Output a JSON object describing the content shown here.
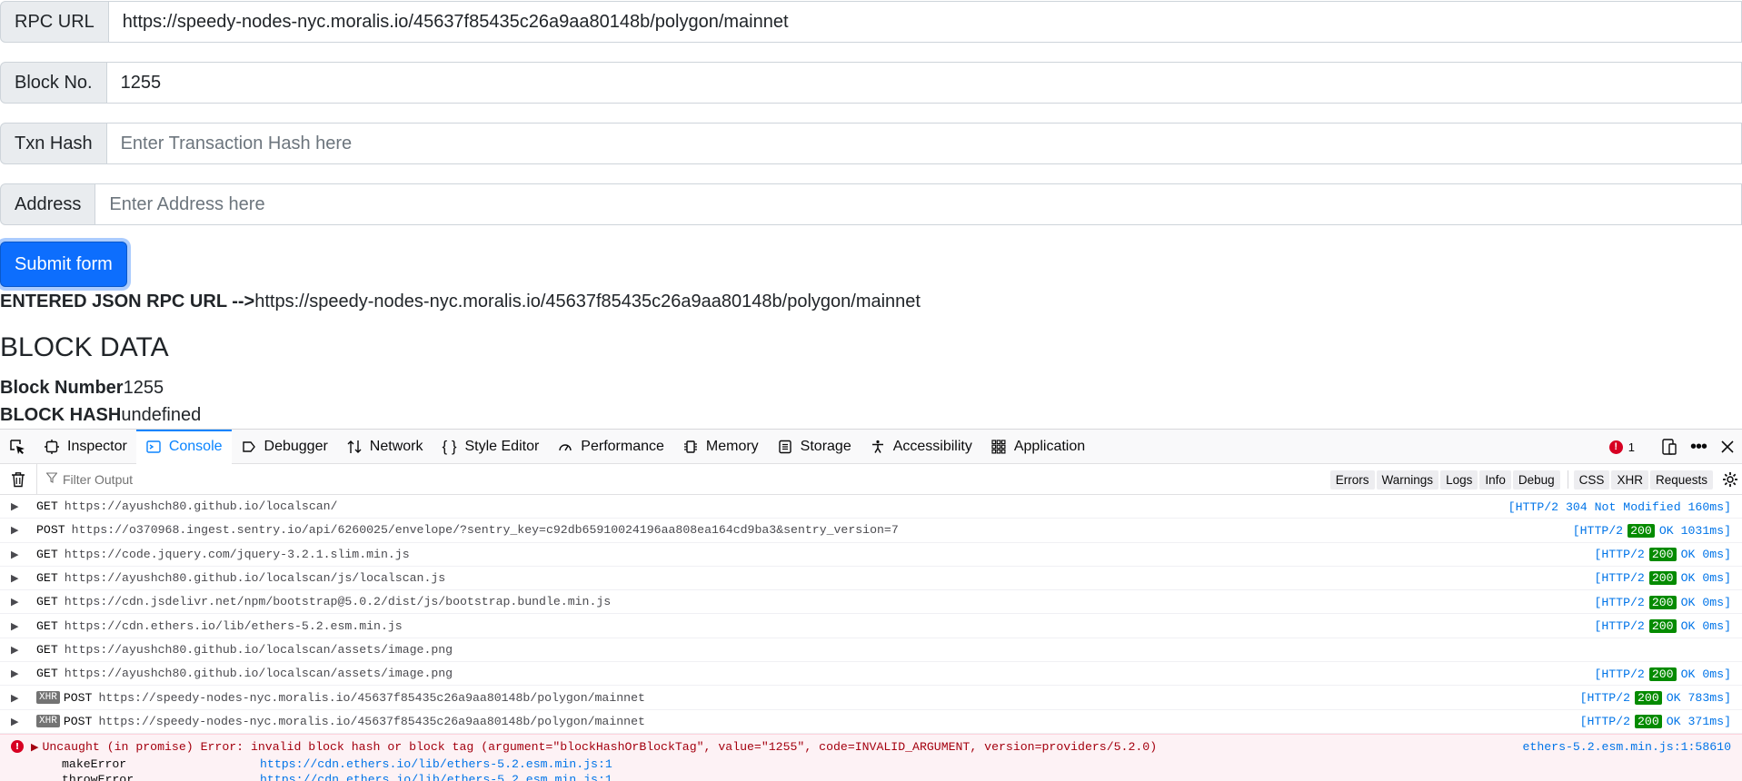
{
  "form": {
    "rpc": {
      "label": "RPC URL",
      "value": "https://speedy-nodes-nyc.moralis.io/45637f85435c26a9aa80148b/polygon/mainnet",
      "placeholder": ""
    },
    "block": {
      "label": "Block No.",
      "value": "1255",
      "placeholder": ""
    },
    "txn": {
      "label": "Txn Hash",
      "value": "",
      "placeholder": "Enter Transaction Hash here"
    },
    "address": {
      "label": "Address",
      "value": "",
      "placeholder": "Enter Address here"
    },
    "submit_label": "Submit form"
  },
  "result": {
    "rpc_label": "ENTERED JSON RPC URL -->",
    "rpc_value": "https://speedy-nodes-nyc.moralis.io/45637f85435c26a9aa80148b/polygon/mainnet",
    "block_title": "BLOCK DATA",
    "block_number_label": "Block Number",
    "block_number_value": "1255",
    "block_hash_label": "BLOCK HASH",
    "block_hash_value": "undefined"
  },
  "devtools": {
    "tabs": [
      {
        "label": "Inspector",
        "icon": "inspector-icon"
      },
      {
        "label": "Console",
        "icon": "console-icon",
        "active": true
      },
      {
        "label": "Debugger",
        "icon": "debugger-icon"
      },
      {
        "label": "Network",
        "icon": "network-icon"
      },
      {
        "label": "Style Editor",
        "icon": "style-editor-icon"
      },
      {
        "label": "Performance",
        "icon": "performance-icon"
      },
      {
        "label": "Memory",
        "icon": "memory-icon"
      },
      {
        "label": "Storage",
        "icon": "storage-icon"
      },
      {
        "label": "Accessibility",
        "icon": "accessibility-icon"
      },
      {
        "label": "Application",
        "icon": "application-icon"
      }
    ],
    "error_count": "1",
    "filter_placeholder": "Filter Output",
    "filters": [
      "Errors",
      "Warnings",
      "Logs",
      "Info",
      "Debug"
    ],
    "filters2": [
      "CSS",
      "XHR",
      "Requests"
    ],
    "log": [
      {
        "xhr": false,
        "method": "GET",
        "url": "https://ayushch80.github.io/localscan/",
        "status_pre": "[HTTP/2 304 Not Modified 160ms]",
        "code": "",
        "status_post": ""
      },
      {
        "xhr": false,
        "method": "POST",
        "url": "https://o370968.ingest.sentry.io/api/6260025/envelope/?sentry_key=c92db65910024196aa808ea164cd9ba3&sentry_version=7",
        "status_pre": "[HTTP/2",
        "code": "200",
        "status_post": "OK 1031ms]"
      },
      {
        "xhr": false,
        "method": "GET",
        "url": "https://code.jquery.com/jquery-3.2.1.slim.min.js",
        "status_pre": "[HTTP/2",
        "code": "200",
        "status_post": "OK 0ms]"
      },
      {
        "xhr": false,
        "method": "GET",
        "url": "https://ayushch80.github.io/localscan/js/localscan.js",
        "status_pre": "[HTTP/2",
        "code": "200",
        "status_post": "OK 0ms]"
      },
      {
        "xhr": false,
        "method": "GET",
        "url": "https://cdn.jsdelivr.net/npm/bootstrap@5.0.2/dist/js/bootstrap.bundle.min.js",
        "status_pre": "[HTTP/2",
        "code": "200",
        "status_post": "OK 0ms]"
      },
      {
        "xhr": false,
        "method": "GET",
        "url": "https://cdn.ethers.io/lib/ethers-5.2.esm.min.js",
        "status_pre": "[HTTP/2",
        "code": "200",
        "status_post": "OK 0ms]"
      },
      {
        "xhr": false,
        "method": "GET",
        "url": "https://ayushch80.github.io/localscan/assets/image.png",
        "status_pre": "",
        "code": "",
        "status_post": ""
      },
      {
        "xhr": false,
        "method": "GET",
        "url": "https://ayushch80.github.io/localscan/assets/image.png",
        "status_pre": "[HTTP/2",
        "code": "200",
        "status_post": "OK 0ms]"
      },
      {
        "xhr": true,
        "method": "POST",
        "url": "https://speedy-nodes-nyc.moralis.io/45637f85435c26a9aa80148b/polygon/mainnet",
        "status_pre": "[HTTP/2",
        "code": "200",
        "status_post": "OK 783ms]"
      },
      {
        "xhr": true,
        "method": "POST",
        "url": "https://speedy-nodes-nyc.moralis.io/45637f85435c26a9aa80148b/polygon/mainnet",
        "status_pre": "[HTTP/2",
        "code": "200",
        "status_post": "OK 371ms]"
      }
    ],
    "xhr_badge": "XHR",
    "error": {
      "message": "Uncaught (in promise) Error: invalid block hash or block tag (argument=\"blockHashOrBlockTag\", value=\"1255\", code=INVALID_ARGUMENT, version=providers/5.2.0)",
      "source": "ethers-5.2.esm.min.js:1:58610",
      "stack": [
        {
          "fn": "makeError",
          "loc": "https://cdn.ethers.io/lib/ethers-5.2.esm.min.js:1"
        },
        {
          "fn": "throwError",
          "loc": "https://cdn.ethers.io/lib/ethers-5.2.esm.min.js:1"
        }
      ]
    }
  }
}
